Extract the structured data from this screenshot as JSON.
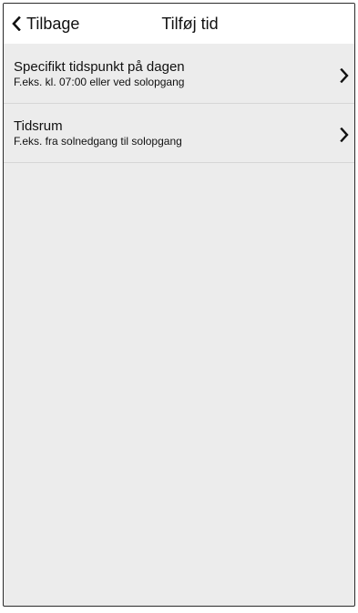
{
  "header": {
    "back_label": "Tilbage",
    "title": "Tilføj tid"
  },
  "options": [
    {
      "title": "Specifikt tidspunkt på dagen",
      "subtitle": "F.eks. kl. 07:00 eller ved solopgang",
      "icon": "chevron-right-icon"
    },
    {
      "title": "Tidsrum",
      "subtitle": "F.eks. fra solnedgang til solopgang",
      "icon": "chevron-right-icon"
    }
  ],
  "colors": {
    "background": "#ececec",
    "header_background": "#ffffff",
    "text": "#111111",
    "divider": "#d6d6d6"
  }
}
